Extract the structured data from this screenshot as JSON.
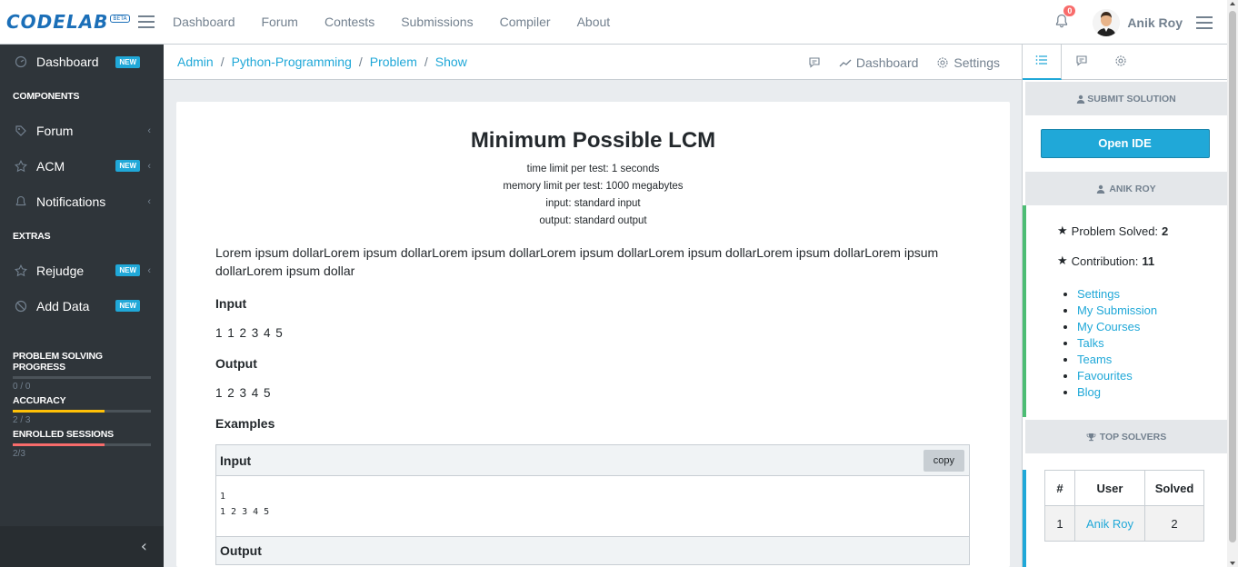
{
  "brand": {
    "name": "CODELAB",
    "badge": "BETA"
  },
  "topnav": [
    "Dashboard",
    "Forum",
    "Contests",
    "Submissions",
    "Compiler",
    "About"
  ],
  "user": {
    "name": "Anik Roy",
    "notifications": "0"
  },
  "sidebar": {
    "items": [
      {
        "label": "Dashboard",
        "badge": "NEW",
        "icon": "speedometer-icon"
      },
      {
        "label": "Forum",
        "icon": "tag-icon"
      },
      {
        "label": "ACM",
        "badge": "NEW",
        "icon": "star-icon"
      },
      {
        "label": "Notifications",
        "icon": "bell-icon"
      },
      {
        "label": "Rejudge",
        "badge": "NEW",
        "icon": "star-icon"
      },
      {
        "label": "Add Data",
        "badge": "NEW",
        "icon": "ban-icon"
      }
    ],
    "section_components": "COMPONENTS",
    "section_extras": "EXTRAS",
    "progress": [
      {
        "title": "PROBLEM SOLVING PROGRESS",
        "value": "0 / 0",
        "fraction": 0,
        "color": "#20a8d8"
      },
      {
        "title": "ACCURACY",
        "value": "2 / 3",
        "fraction": 0.667,
        "color": "#ffc107"
      },
      {
        "title": "ENROLLED SESSIONS",
        "value": "2/3",
        "fraction": 0.667,
        "color": "#f86c6b"
      }
    ]
  },
  "breadcrumb": {
    "items": [
      "Admin",
      "Python-Programming",
      "Problem",
      "Show"
    ],
    "dashboard": "Dashboard",
    "settings": "Settings"
  },
  "problem": {
    "title": "Minimum Possible LCM",
    "time_limit": "time limit per test: 1 seconds",
    "memory_limit": "memory limit per test: 1000 megabytes",
    "input": "input: standard input",
    "output": "output: standard output",
    "description": "Lorem ipsum dollarLorem ipsum dollarLorem ipsum dollarLorem ipsum dollarLorem ipsum dollarLorem ipsum dollarLorem ipsum dollarLorem ipsum dollar",
    "input_heading": "Input",
    "input_value": "1 1 2 3 4 5",
    "output_heading": "Output",
    "output_value": "1 2 3 4 5",
    "examples_heading": "Examples",
    "example_input_label": "Input",
    "copy_label": "copy",
    "example_input": "1\n1 2 3 4 5",
    "example_output_label": "Output"
  },
  "aside": {
    "submit_heading": "SUBMIT SOLUTION",
    "open_ide": "Open IDE",
    "user_heading": "ANIK ROY",
    "problem_solved_label": "Problem Solved:",
    "problem_solved": "2",
    "contribution_label": "Contribution:",
    "contribution": "11",
    "links": [
      "Settings",
      "My Submission",
      "My Courses",
      "Talks",
      "Teams",
      "Favourites",
      "Blog"
    ],
    "top_solvers_heading": "TOP SOLVERS",
    "table": {
      "headers": [
        "#",
        "User",
        "Solved"
      ],
      "rows": [
        [
          "1",
          "Anik Roy",
          "2"
        ]
      ]
    }
  },
  "colors": {
    "accent": "#20a8d8",
    "sidebar": "#2f353a",
    "green": "#4dbd74",
    "warning": "#ffc107",
    "danger": "#f86c6b"
  }
}
